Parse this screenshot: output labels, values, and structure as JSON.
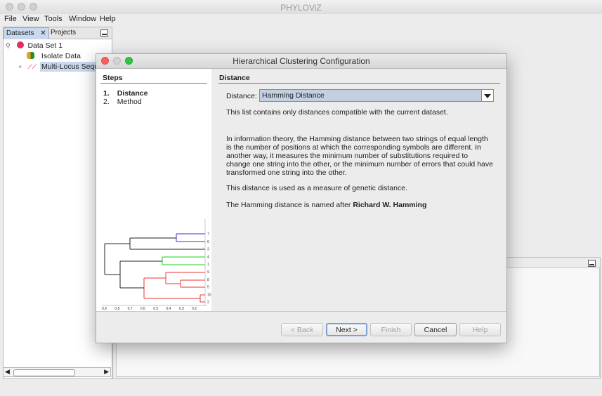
{
  "app": {
    "title": "PHYLOViZ"
  },
  "menu": {
    "file": "File",
    "view": "View",
    "tools": "Tools",
    "window": "Window",
    "help": "Help"
  },
  "left_panel": {
    "tabs": [
      "Datasets",
      "Projects"
    ],
    "tree": {
      "root": "Data Set 1",
      "child1": "Isolate Data",
      "child2": "Multi-Locus Sequ"
    }
  },
  "dialog": {
    "title": "Hierarchical Clustering Configuration",
    "steps_heading": "Steps",
    "steps": [
      {
        "num": "1.",
        "label": "Distance"
      },
      {
        "num": "2.",
        "label": "Method"
      }
    ],
    "content_heading": "Distance",
    "distance_label": "Distance:",
    "distance_value": "Hamming Distance",
    "hint": "This list contains only distances compatible with the current dataset.",
    "desc_1": "In information theory, the Hamming distance between two strings of equal length is the number of positions at which the corresponding symbols are different. In another way, it measures the minimum number of substitutions required to change one string into the other, or the minimum number of errors that could have transformed one string into the other.",
    "desc_2": "This distance is used as a measure of genetic distance.",
    "desc_3_prefix": "The Hamming distance is named after",
    "desc_3_name": "Richard W. Hamming",
    "buttons": {
      "back": "< Back",
      "next": "Next >",
      "finish": "Finish",
      "cancel": "Cancel",
      "help": "Help"
    }
  },
  "dendrogram": {
    "leaf_labels": [
      "7",
      "6",
      "3",
      "4",
      "1",
      "9",
      "8",
      "5",
      "10",
      "2"
    ],
    "axis_ticks": [
      "0.9",
      "0.8",
      "0.7",
      "0.6",
      "0.5",
      "0.4",
      "0.3",
      "0.2"
    ],
    "colors": {
      "blue": "#3333cc",
      "green": "#22cc22",
      "red": "#ee3333",
      "black": "#222222"
    }
  }
}
